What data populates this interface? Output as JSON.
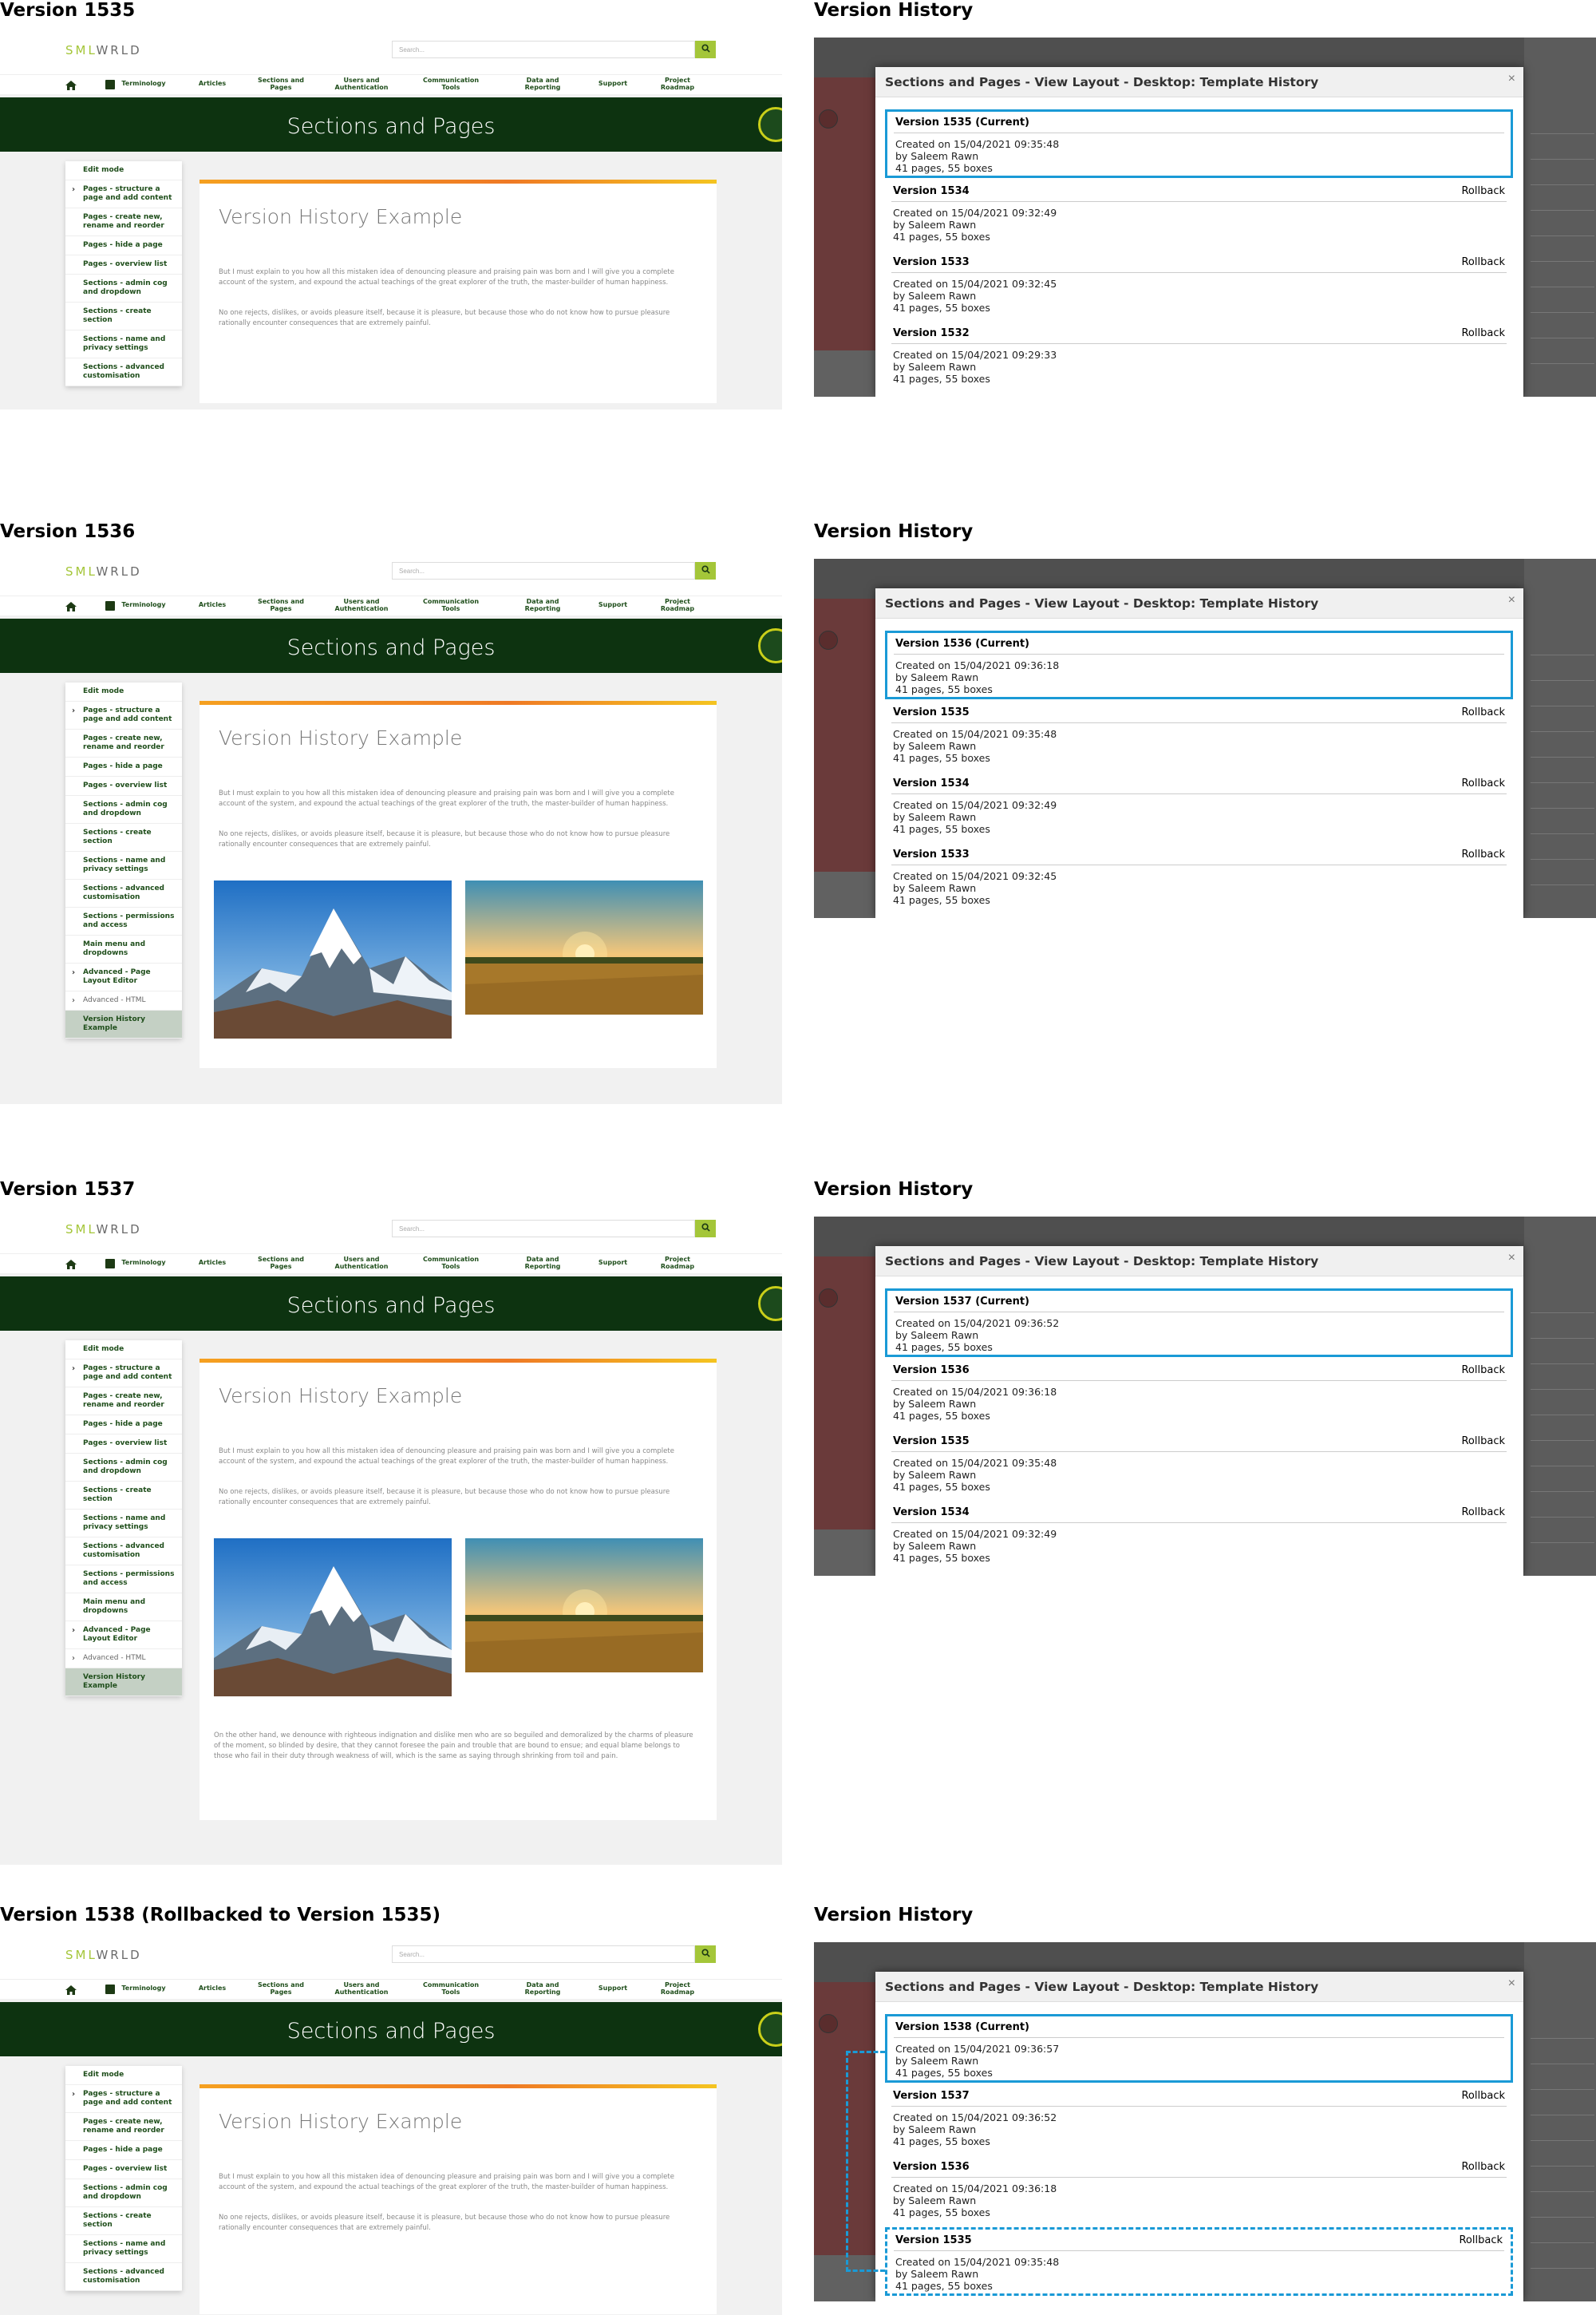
{
  "site": {
    "logo_a": "SML",
    "logo_b": "WRLD",
    "search_placeholder": "Search...",
    "nav": [
      "Terminology",
      "Articles",
      "Sections and\nPages",
      "Users and\nAuthentication",
      "Communication\nTools",
      "Data and\nReporting",
      "Support",
      "Project\nRoadmap"
    ],
    "banner_title": "Sections and Pages",
    "content_title": "Version History Example",
    "paragraph_1": "But I must explain to you how all this mistaken idea of denouncing pleasure and praising pain was born and I will give you a complete account of the system, and expound the actual teachings of the great explorer of the truth, the master-builder of human happiness.",
    "paragraph_2": "No one rejects, dislikes, or avoids pleasure itself, because it is pleasure, but because those who do not know how to pursue pleasure rationally encounter consequences that are extremely painful.",
    "paragraph_3": "On the other hand, we denounce with righteous indignation and dislike men who are so beguiled and demoralized by the charms of pleasure of the moment, so blinded by desire, that they cannot foresee the pain and trouble that are bound to ensue; and equal blame belongs to those who fail in their duty through weakness of will, which is the same as saying through shrinking from toil and pain.",
    "sidebar": [
      {
        "label": "Edit mode",
        "chev": false
      },
      {
        "label": "Pages - structure a page and add content",
        "chev": true
      },
      {
        "label": "Pages - create new, rename and reorder",
        "chev": false
      },
      {
        "label": "Pages - hide a page",
        "chev": false
      },
      {
        "label": "Pages - overview list",
        "chev": false
      },
      {
        "label": "Sections - admin cog and dropdown",
        "chev": false
      },
      {
        "label": "Sections - create section",
        "chev": false
      },
      {
        "label": "Sections - name and privacy settings",
        "chev": false
      },
      {
        "label": "Sections - advanced customisation",
        "chev": false
      },
      {
        "label": "Sections - permissions and access",
        "chev": false
      },
      {
        "label": "Main menu and dropdowns",
        "chev": false
      },
      {
        "label": "Advanced - Page Layout Editor",
        "chev": true
      },
      {
        "label": "Advanced - HTML",
        "chev": true,
        "grey": true
      },
      {
        "label": "Version History Example",
        "chev": false,
        "active": true
      }
    ]
  },
  "history": {
    "panel_title": "Version History",
    "dialog_title": "Sections and Pages - View Layout - Desktop: Template History",
    "close_glyph": "×",
    "rollback_label": "Rollback",
    "current_suffix": "(Current)",
    "author": "by Saleem Rawn",
    "stats": "41 pages, 55 boxes"
  },
  "versions": {
    "1538": "Created on 15/04/2021 09:36:57",
    "1537": "Created on 15/04/2021 09:36:52",
    "1536": "Created on 15/04/2021 09:36:18",
    "1535": "Created on 15/04/2021 09:35:48",
    "1534": "Created on 15/04/2021 09:32:49",
    "1533": "Created on 15/04/2021 09:32:45",
    "1532": "Created on 15/04/2021 09:29:33"
  },
  "rows": [
    {
      "title": "Version 1535",
      "list": [
        "1535",
        "1534",
        "1533",
        "1532"
      ]
    },
    {
      "title": "Version 1536",
      "list": [
        "1536",
        "1535",
        "1534",
        "1533"
      ]
    },
    {
      "title": "Version 1537",
      "list": [
        "1537",
        "1536",
        "1535",
        "1534"
      ]
    },
    {
      "title": "Version 1538 (Rollbacked to Version 1535)",
      "list": [
        "1538",
        "1537",
        "1536",
        "1535"
      ]
    }
  ]
}
